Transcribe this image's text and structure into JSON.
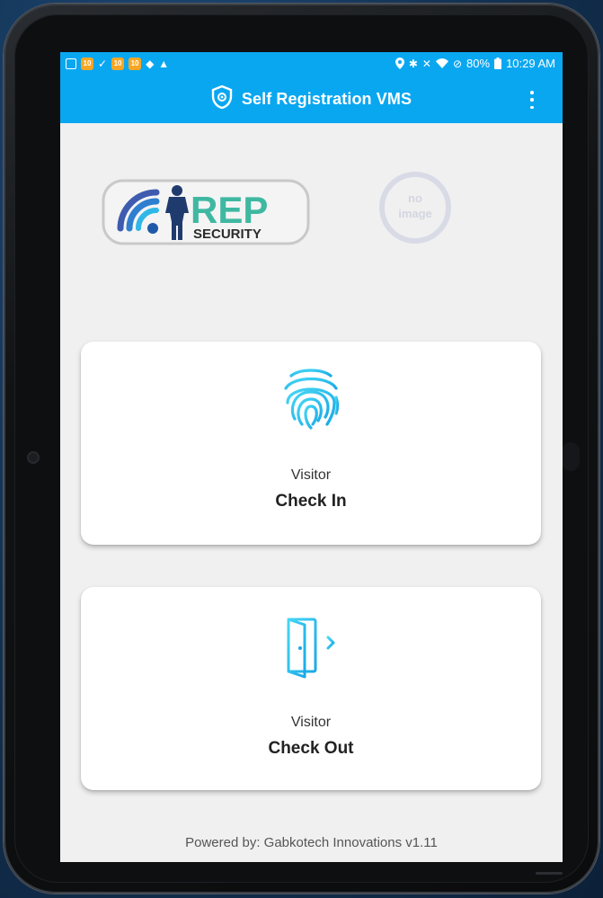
{
  "statusbar": {
    "left_icons": [
      "image-icon",
      "orange-app-icon",
      "download-done-icon",
      "orange-app-icon",
      "orange-app-icon",
      "nav-icon",
      "warning-icon"
    ],
    "battery": "80%",
    "time": "10:29 AM"
  },
  "appbar": {
    "title": "Self Registration VMS",
    "icon": "shield-icon",
    "menu_icon": "more-vert-icon"
  },
  "logos": {
    "left": {
      "big_text": "REP",
      "small_text": "SECURITY"
    },
    "right": {
      "line1": "no",
      "line2": "image"
    }
  },
  "cards": {
    "checkin": {
      "sub": "Visitor",
      "main": "Check In",
      "icon": "fingerprint-icon"
    },
    "checkout": {
      "sub": "Visitor",
      "main": "Check Out",
      "icon": "exit-door-icon"
    }
  },
  "footer": "Powered by: Gabkotech Innovations v1.11",
  "colors": {
    "accent": "#0aa7f1",
    "background": "#f0f0f0",
    "icon_cyan": "#22c3ee"
  }
}
